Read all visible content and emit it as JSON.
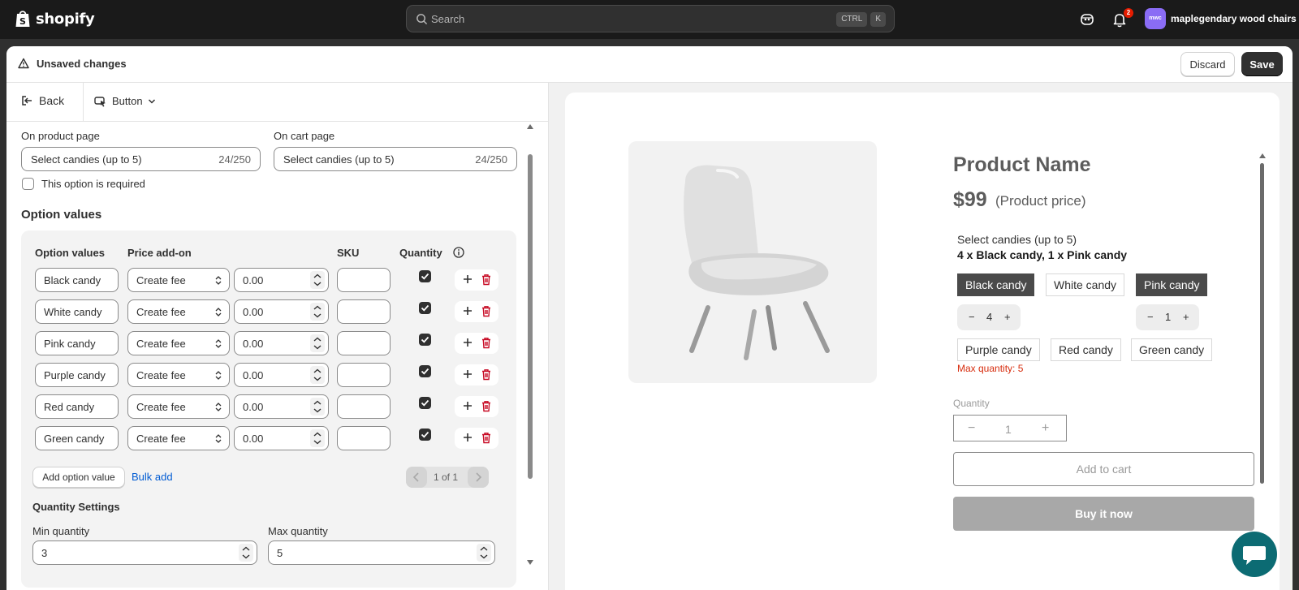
{
  "topbar": {
    "brand": "shopify",
    "search_placeholder": "Search",
    "shortcut_keys": [
      "CTRL",
      "K"
    ],
    "notification_count": "2",
    "avatar_initials": "mwc",
    "store_name": "maplegendary wood chairs"
  },
  "savebar": {
    "title": "Unsaved changes",
    "discard_label": "Discard",
    "save_label": "Save"
  },
  "editor": {
    "back_label": "Back",
    "element_label": "Button",
    "product_page_label": "On product page",
    "product_page_value": "Select candies (up to 5)",
    "product_page_count": "24/250",
    "cart_page_label": "On cart page",
    "cart_page_value": "Select candies (up to 5)",
    "cart_page_count": "24/250",
    "required_label": "This option is required",
    "option_values_heading": "Option values",
    "columns": {
      "option_values": "Option values",
      "price_addon": "Price add-on",
      "sku": "SKU",
      "quantity": "Quantity"
    },
    "rows": [
      {
        "name": "Black candy",
        "fee": "Create fee",
        "price": "0.00",
        "sku": "",
        "quantity_checked": true
      },
      {
        "name": "White candy",
        "fee": "Create fee",
        "price": "0.00",
        "sku": "",
        "quantity_checked": true
      },
      {
        "name": "Pink candy",
        "fee": "Create fee",
        "price": "0.00",
        "sku": "",
        "quantity_checked": true
      },
      {
        "name": "Purple candy",
        "fee": "Create fee",
        "price": "0.00",
        "sku": "",
        "quantity_checked": true
      },
      {
        "name": "Red candy",
        "fee": "Create fee",
        "price": "0.00",
        "sku": "",
        "quantity_checked": true
      },
      {
        "name": "Green candy",
        "fee": "Create fee",
        "price": "0.00",
        "sku": "",
        "quantity_checked": true
      }
    ],
    "add_option_label": "Add option value",
    "bulk_add_label": "Bulk add",
    "pagination": "1 of 1",
    "quantity_settings_heading": "Quantity Settings",
    "min_quantity_label": "Min quantity",
    "min_quantity_value": "3",
    "max_quantity_label": "Max quantity",
    "max_quantity_value": "5"
  },
  "preview": {
    "product_name": "Product Name",
    "price": "$99",
    "price_note": "(Product price)",
    "option_title": "Select candies (up to 5)",
    "option_summary": "4 x Black candy, 1 x Pink candy",
    "chips": [
      {
        "label": "Black candy",
        "selected": true
      },
      {
        "label": "White candy",
        "selected": false
      },
      {
        "label": "Pink candy",
        "selected": true
      },
      {
        "label": "Purple candy",
        "selected": false
      },
      {
        "label": "Red candy",
        "selected": false
      },
      {
        "label": "Green candy",
        "selected": false
      }
    ],
    "black_qty": "4",
    "pink_qty": "1",
    "max_quantity_msg": "Max quantity: 5",
    "quantity_label": "Quantity",
    "quantity_value": "1",
    "minus": "−",
    "plus": "+",
    "add_to_cart": "Add to cart",
    "buy_now": "Buy it now"
  },
  "colors": {
    "topbar_bg": "#1a1a1a",
    "save_bg": "#303030",
    "link": "#005bd3",
    "error": "#d72c0d",
    "chat_bubble": "#0c6b73",
    "avatar": "#8a6cf5",
    "selected_chip": "#4a4a4a"
  }
}
